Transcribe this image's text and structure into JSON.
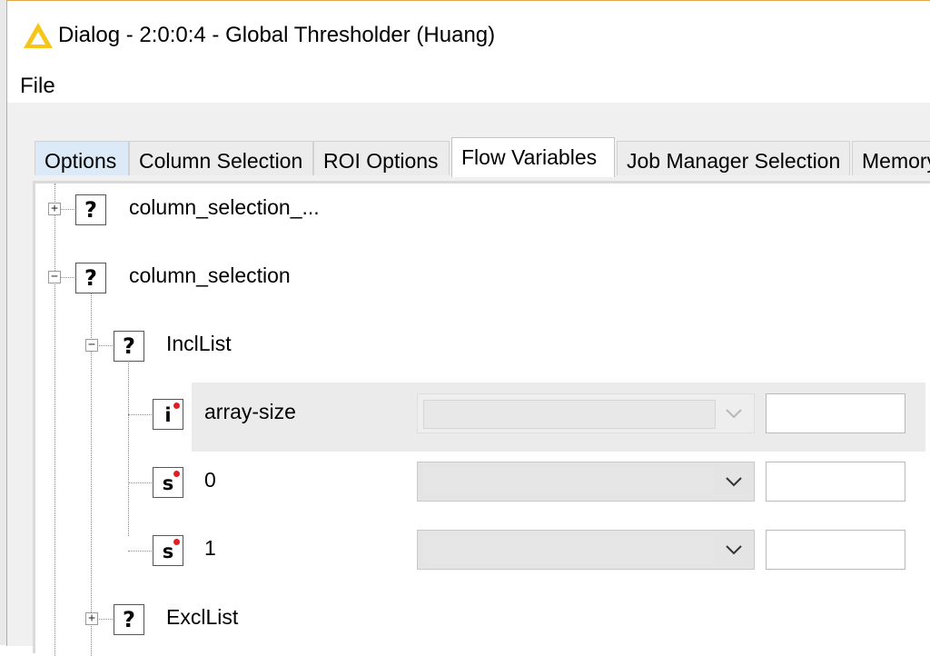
{
  "window": {
    "title": "Dialog - 2:0:0:4 - Global Thresholder (Huang)",
    "icon": "knime-warning-triangle-icon",
    "accent_color": "#e3a64b"
  },
  "menu": {
    "file_label": "File"
  },
  "tabs": [
    {
      "label": "Options",
      "active": false
    },
    {
      "label": "Column Selection",
      "active": false
    },
    {
      "label": "ROI Options",
      "active": false
    },
    {
      "label": "Flow Variables",
      "active": true
    },
    {
      "label": "Job Manager Selection",
      "active": false
    },
    {
      "label": "Memory",
      "active": false
    }
  ],
  "tree": {
    "nodes": [
      {
        "label": "column_selection_...",
        "icon": "?",
        "expanded": false
      },
      {
        "label": "column_selection",
        "icon": "?",
        "expanded": true
      },
      {
        "label": "InclList",
        "icon": "?",
        "expanded": true
      },
      {
        "label": "array-size",
        "icon": "i",
        "variable": true,
        "combo_value": "",
        "text_value": "",
        "disabled": true
      },
      {
        "label": "0",
        "icon": "s",
        "variable": true,
        "combo_value": "",
        "text_value": ""
      },
      {
        "label": "1",
        "icon": "s",
        "variable": true,
        "combo_value": "",
        "text_value": ""
      },
      {
        "label": "ExclList",
        "icon": "?",
        "expanded": false
      }
    ]
  }
}
